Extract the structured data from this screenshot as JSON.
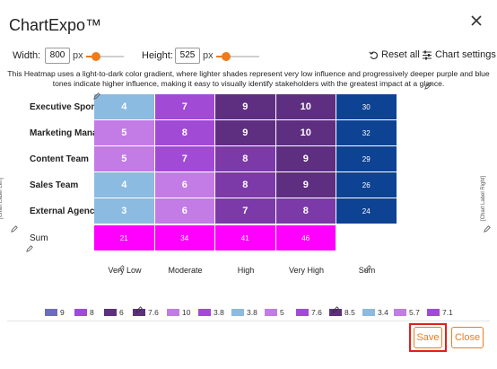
{
  "app": {
    "title": "ChartExpo™",
    "close_icon": "close-icon"
  },
  "toolbar": {
    "width_label": "Width:",
    "width_value": "800",
    "width_unit": "px",
    "height_label": "Height:",
    "height_value": "525",
    "height_unit": "px",
    "reset_label": "Reset all",
    "settings_label": "Chart settings",
    "accent_color": "#f07b1b"
  },
  "description": "This Heatmap uses a light-to-dark color gradient, where lighter shades represent very low influence and progressively deeper purple and blue tones indicate higher influence, making it easy to visually identify stakeholders with the greatest impact at a glance.",
  "chart_data": {
    "type": "heatmap",
    "rows": [
      "Executive Sponsor",
      "Marketing Manager",
      "Content Team",
      "Sales Team",
      "External Agency"
    ],
    "columns": [
      "Very Low",
      "Moderate",
      "High",
      "Very High"
    ],
    "values": [
      [
        4,
        7,
        9,
        10
      ],
      [
        5,
        8,
        9,
        10
      ],
      [
        5,
        7,
        8,
        9
      ],
      [
        4,
        6,
        8,
        9
      ],
      [
        3,
        6,
        7,
        8
      ]
    ],
    "cell_colors": [
      [
        "#8bbbe0",
        "#a14ad6",
        "#5e2f80",
        "#5e2f80"
      ],
      [
        "#c37be6",
        "#a14ad6",
        "#5e2f80",
        "#5e2f80"
      ],
      [
        "#c37be6",
        "#a14ad6",
        "#7c3aa8",
        "#5e2f80"
      ],
      [
        "#8bbbe0",
        "#c37be6",
        "#7c3aa8",
        "#5e2f80"
      ],
      [
        "#8bbbe0",
        "#c37be6",
        "#7c3aa8",
        "#7c3aa8"
      ]
    ],
    "row_totals": [
      30,
      32,
      29,
      26,
      24
    ],
    "row_total_color": "#0e4394",
    "column_totals": [
      21,
      34,
      41,
      46
    ],
    "column_total_color": "#ff00ff",
    "sum_label": "Sum",
    "left_axis_label": "[Chart Label Left]",
    "right_axis_label": "[Chart Label Right]"
  },
  "legend": [
    {
      "label": "9",
      "color": "#6d6dc0"
    },
    {
      "label": "8",
      "color": "#a14ad6"
    },
    {
      "label": "6",
      "color": "#5e2f80"
    },
    {
      "label": "7.6",
      "color": "#5e2f80"
    },
    {
      "label": "10",
      "color": "#c37be6"
    },
    {
      "label": "3.8",
      "color": "#a14ad6"
    },
    {
      "label": "3.8",
      "color": "#8bbbe0"
    },
    {
      "label": "5",
      "color": "#c37be6"
    },
    {
      "label": "7.6",
      "color": "#a14ad6"
    },
    {
      "label": "8.5",
      "color": "#5e2f80"
    },
    {
      "label": "3.4",
      "color": "#8bbbe0"
    },
    {
      "label": "5.7",
      "color": "#c37be6"
    },
    {
      "label": "7.1",
      "color": "#a14ad6"
    }
  ],
  "footer": {
    "save_label": "Save",
    "close_label": "Close"
  }
}
